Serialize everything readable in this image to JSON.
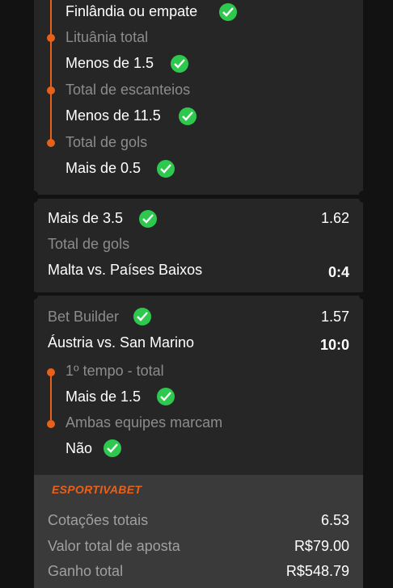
{
  "bet1": {
    "sel1": "Finlândia ou empate",
    "market2": "Lituânia total",
    "sel2": "Menos de 1.5",
    "market3": "Total de escanteios",
    "sel3": "Menos de 11.5",
    "market4": "Total de gols",
    "sel4": "Mais de 0.5"
  },
  "bet2": {
    "selection": "Mais de 3.5",
    "odds": "1.62",
    "market": "Total de gols",
    "match": "Malta vs. Países Baixos",
    "score": "0:4"
  },
  "bet3": {
    "type": "Bet Builder",
    "odds": "1.57",
    "match": "Áustria vs. San Marino",
    "score": "10:0",
    "market1": "1º tempo - total",
    "sel1": "Mais de 1.5",
    "market2": "Ambas equipes marcam",
    "sel2": "Não"
  },
  "summary": {
    "brand": "ESPORTIVABET",
    "total_odds_label": "Cotações totais",
    "total_odds": "6.53",
    "stake_label": "Valor total de aposta",
    "stake": "R$79.00",
    "win_label": "Ganho total",
    "win": "R$548.79"
  },
  "colors": {
    "accent": "#e8611a",
    "check": "#2ec84e",
    "card": "#262626",
    "summary": "#3a3a3a"
  }
}
